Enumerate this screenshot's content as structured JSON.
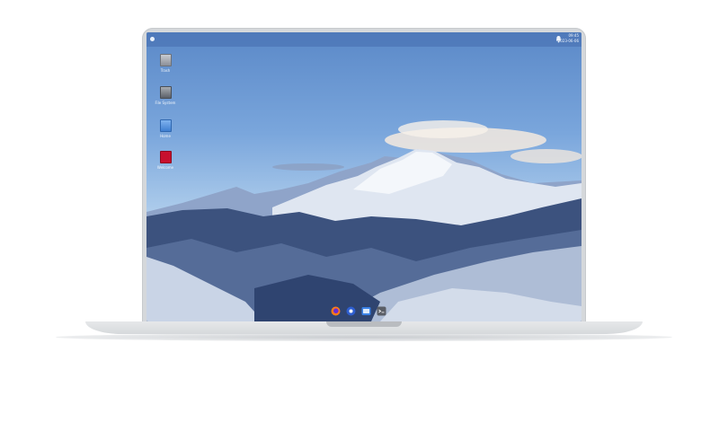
{
  "desktop": {
    "clock": {
      "time": "09:45",
      "date": "2023-06-06"
    },
    "icons": [
      {
        "label": "Trash",
        "icon": "trash-icon"
      },
      {
        "label": "File System",
        "icon": "harddrive-icon"
      },
      {
        "label": "Home",
        "icon": "home-folder-icon"
      },
      {
        "label": "Welcome",
        "icon": "raspberry-app-icon"
      }
    ]
  },
  "dock": {
    "items": [
      {
        "name": "Firefox",
        "icon": "firefox-icon"
      },
      {
        "name": "Chromium",
        "icon": "browser-icon"
      },
      {
        "name": "Files",
        "icon": "files-icon"
      },
      {
        "name": "Terminal",
        "icon": "terminal-icon"
      }
    ]
  },
  "colors": {
    "sky_top": "#5b89c8",
    "sky_bottom": "#c5dcf1",
    "frame": "#d5d8db",
    "mountain_dark": "#2a3b63"
  }
}
